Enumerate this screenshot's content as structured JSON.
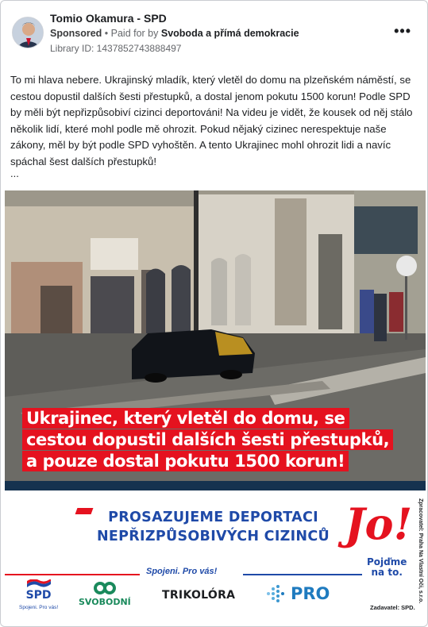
{
  "post": {
    "author": "Tomio Okamura - SPD",
    "sponsored_label": "Sponsored",
    "paid_for_by_prefix": "• Paid for by",
    "payer": "Svoboda a přímá demokracie",
    "library_id": "Library ID: 1437852743888497",
    "more_label": "•••",
    "text": "To mi hlava nebere. Ukrajinský mladík, který vletěl do domu na plzeňském náměstí, se cestou dopustil dalších šesti přestupků, a dostal jenom pokutu 1500 korun! Podle SPD by měli být nepřizpůsobiví cizinci deportováni! Na videu je vidět, že kousek od něj stálo několik lidí, které mohl podle mě ohrozit. Pokud nějaký cizinec nerespektuje naše zákony, měl by být podle SPD vyhoštěn. A tento Ukrajinec mohl ohrozit lidi a navíc spáchal šest dalších přestupků!",
    "ellipsis": "..."
  },
  "media": {
    "caption_lines": [
      "Ukrajinec, který vletěl do domu, se",
      "cestou dopustil dalších šesti přestupků,",
      "a pouze dostal pokutu 1500 korun!"
    ],
    "banner": {
      "headline_1": "PROSAZUJEME DEPORTACI",
      "headline_2": "NEPŘIZPŮSOBIVÝCH CIZINCŮ",
      "jo": "Jo!",
      "jo_sub_1": "Pojďme",
      "jo_sub_2": "na to.",
      "spojeni": "Spojeni. Pro vás!",
      "logos": {
        "spd": "SPD",
        "spd_sub": "Spojeni. Pro vás!",
        "svobodni": "SVOBODNÍ",
        "trikolora": "TRIKOLÓRA",
        "pro": "PRO"
      },
      "zadavatel": "Zadavatel: SPD.",
      "zpracovatel": "Zpracovatel: Praha Na Vlastní Oči, s.r.o."
    }
  },
  "colors": {
    "accent_red": "#e5121f",
    "accent_blue": "#1f4aa8"
  }
}
